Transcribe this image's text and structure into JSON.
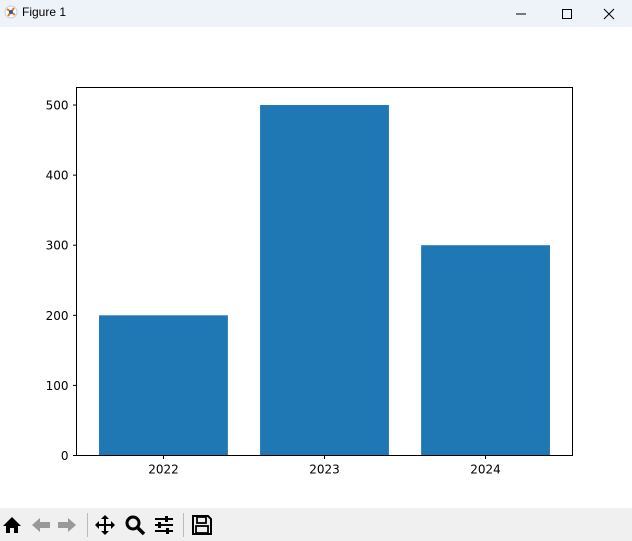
{
  "window": {
    "title": "Figure 1"
  },
  "toolbar": {
    "buttons": [
      "home-icon",
      "back-icon",
      "forward-icon",
      "pan-icon",
      "zoom-icon",
      "configure-subplots-icon",
      "save-icon"
    ]
  },
  "colors": {
    "bar": "#1f77b4",
    "titlebar": "#eef2f9",
    "toolbar": "#f0f0f0"
  },
  "chart_data": {
    "type": "bar",
    "title": "",
    "xlabel": "",
    "ylabel": "",
    "categories": [
      "2022",
      "2023",
      "2024"
    ],
    "values": [
      200,
      500,
      300
    ],
    "bar_width": 0.8,
    "xlim": [
      -0.54,
      2.54
    ],
    "ylim": [
      0,
      525
    ],
    "yticks": [
      0,
      100,
      200,
      300,
      400,
      500
    ],
    "ytick_labels": [
      "0",
      "100",
      "200",
      "300",
      "400",
      "500"
    ],
    "grid": false,
    "legend": null
  }
}
